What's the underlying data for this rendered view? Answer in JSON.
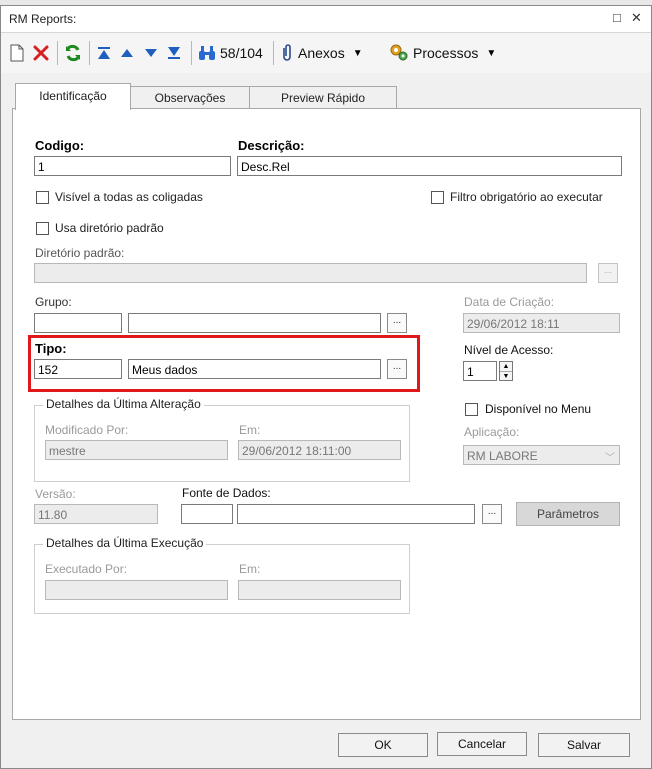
{
  "window": {
    "title": "RM Reports:",
    "min_icon": "□",
    "close_icon": "✕"
  },
  "toolbar": {
    "counter": "58/104",
    "anexos": "Anexos",
    "processos": "Processos",
    "dropdown_glyph": "▼"
  },
  "tabs": [
    {
      "label": "Identificação"
    },
    {
      "label": "Observações"
    },
    {
      "label": "Preview Rápido"
    }
  ],
  "form": {
    "codigo_label": "Codigo:",
    "codigo_value": "1",
    "descricao_label": "Descrição:",
    "descricao_value": "Desc.Rel",
    "visivel_label": "Visível a todas as coligadas",
    "filtro_label": "Filtro obrigatório ao executar",
    "usa_dir_label": "Usa diretório padrão",
    "dir_label": "Diretório padrão:",
    "dir_value": "",
    "grupo_label": "Grupo:",
    "grupo_code": "",
    "grupo_desc": "",
    "data_criacao_label": "Data de Criação:",
    "data_criacao_value": "29/06/2012 18:11",
    "tipo_label": "Tipo:",
    "tipo_code": "152",
    "tipo_desc": "Meus dados",
    "nivel_label": "Nível de Acesso:",
    "nivel_value": "1",
    "detalhes_alt_title": "Detalhes da Última Alteração",
    "modificado_label": "Modificado Por:",
    "modificado_value": "mestre",
    "em_label": "Em:",
    "em_alt_value": "29/06/2012 18:11:00",
    "disponivel_label": "Disponível no Menu",
    "aplicacao_label": "Aplicação:",
    "aplicacao_value": "RM LABORE",
    "versao_label": "Versão:",
    "versao_value": "11.80",
    "fonte_label": "Fonte de Dados:",
    "fonte_code": "",
    "fonte_desc": "",
    "parametros_label": "Parâmetros",
    "detalhes_exec_title": "Detalhes da Última Execução",
    "executado_label": "Executado Por:",
    "executado_value": "",
    "em_exec_value": "",
    "dots": "..."
  },
  "footer": {
    "ok": "OK",
    "cancelar": "Cancelar",
    "salvar": "Salvar"
  },
  "colors": {
    "highlight": "#e0181a",
    "delete_red": "#d42020",
    "refresh_green": "#1e8a1e",
    "nav_blue": "#1f5fbf"
  }
}
